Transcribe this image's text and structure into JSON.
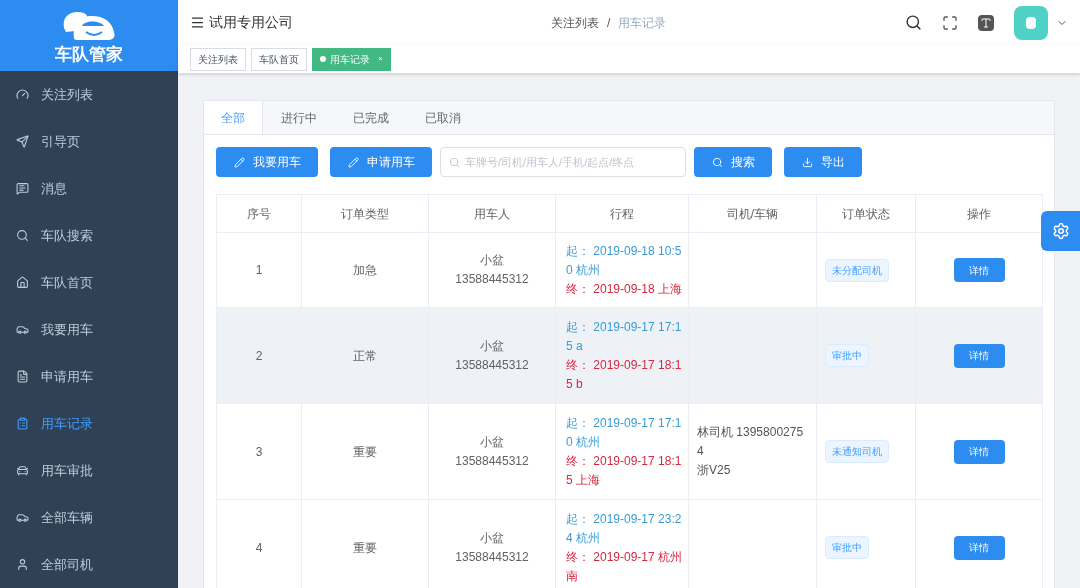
{
  "sidebar": {
    "logo_text": "车队管家",
    "items": [
      {
        "label": "关注列表",
        "selected": false
      },
      {
        "label": "引导页",
        "selected": false
      },
      {
        "label": "消息",
        "selected": false
      },
      {
        "label": "车队搜索",
        "selected": false
      },
      {
        "label": "车队首页",
        "selected": false
      },
      {
        "label": "我要用车",
        "selected": false
      },
      {
        "label": "申请用车",
        "selected": false
      },
      {
        "label": "用车记录",
        "selected": true
      },
      {
        "label": "用车审批",
        "selected": false
      },
      {
        "label": "全部车辆",
        "selected": false
      },
      {
        "label": "全部司机",
        "selected": false
      }
    ]
  },
  "header": {
    "company": "试用专用公司",
    "breadcrumbs": [
      "关注列表",
      "/",
      "用车记录"
    ]
  },
  "tags": [
    {
      "label": "关注列表",
      "selected": false
    },
    {
      "label": "车队首页",
      "selected": false
    },
    {
      "label": "用车记录",
      "selected": true,
      "close": "×"
    }
  ],
  "tabs": [
    {
      "label": "全部",
      "selected": true
    },
    {
      "label": "进行中",
      "selected": false
    },
    {
      "label": "已完成",
      "selected": false
    },
    {
      "label": "已取消",
      "selected": false
    }
  ],
  "toolbar": {
    "buttons": [
      {
        "label": "我要用车"
      },
      {
        "label": "申请用车"
      }
    ],
    "search": {
      "placeholder": "车牌号/司机/用车人/手机/起点/终点"
    },
    "actions": [
      {
        "label": "搜索"
      },
      {
        "label": "导出"
      }
    ]
  },
  "table": {
    "columns": [
      "序号",
      "订单类型",
      "用车人",
      "行程",
      "司机/车辆",
      "订单状态",
      "操作"
    ],
    "rows": [
      {
        "index": "1",
        "type": "加急",
        "user": "小盆",
        "phone": "13588445312",
        "start": "起： 2019-09-18 10:50 杭州",
        "end": "终： 2019-09-18 上海",
        "status": "未分配司机",
        "action": "详情",
        "highlighted": false
      },
      {
        "index": "2",
        "type": "正常",
        "user": "小盆",
        "phone": "13588445312",
        "start": "起： 2019-09-17 17:15 a",
        "end": "终： 2019-09-17 18:15 b",
        "status": "审批中",
        "action": "详情",
        "highlighted": true
      },
      {
        "index": "3",
        "type": "重要",
        "user": "小盆",
        "phone": "13588445312",
        "start": "起： 2019-09-17 17:10 杭州",
        "end": "终： 2019-09-17 18:15 上海",
        "driver": "林司机 13958002754",
        "vehicle": "浙V25",
        "status": "未通知司机",
        "action": "详情",
        "highlighted": false
      },
      {
        "index": "4",
        "type": "重要",
        "user": "小盆",
        "phone": "13588445312",
        "start": "起： 2019-09-17 23:24 杭州",
        "end": "终： 2019-09-17 杭州南",
        "status": "审批中",
        "action": "详情",
        "highlighted": false
      }
    ]
  }
}
